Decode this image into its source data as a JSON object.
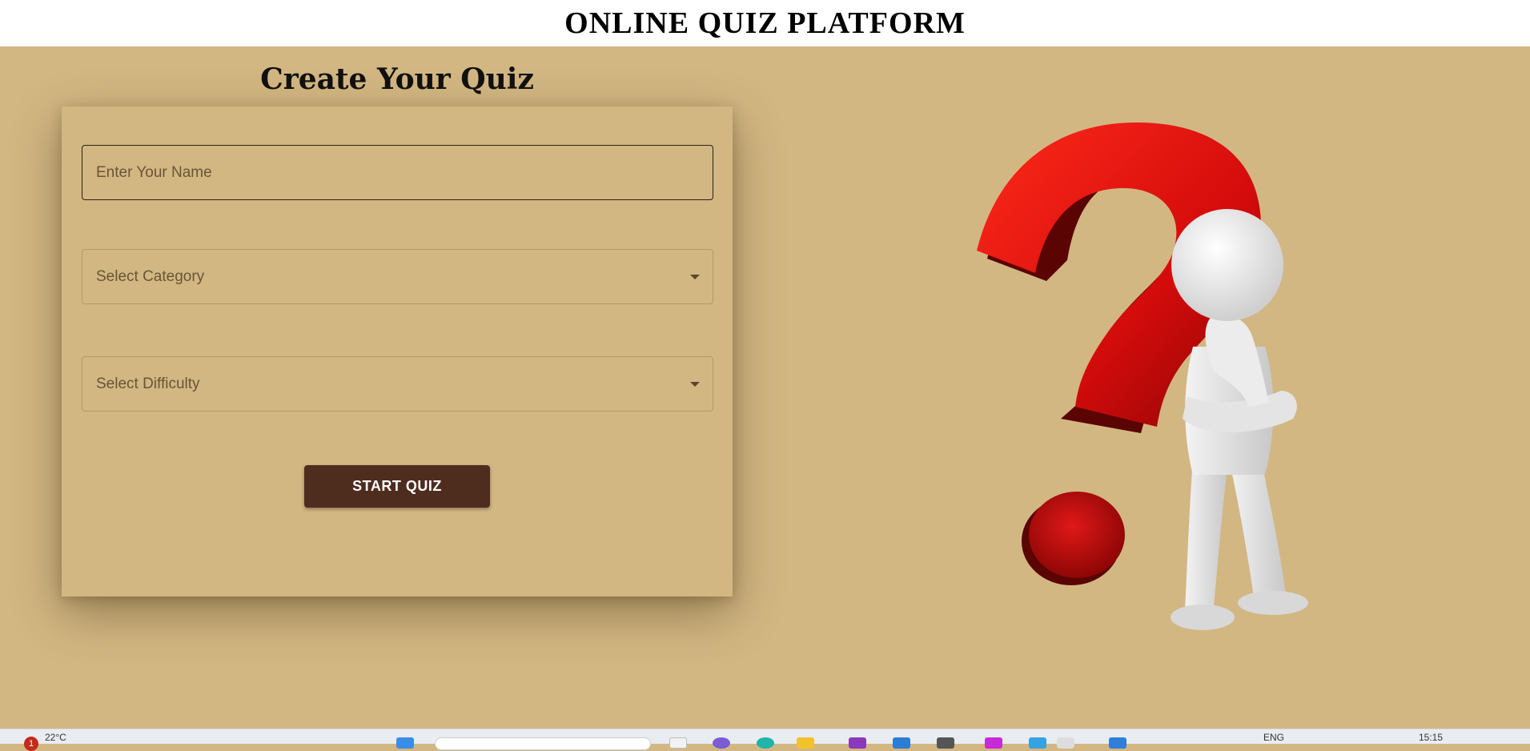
{
  "header": {
    "title": "ONLINE QUIZ PLATFORM"
  },
  "form": {
    "title": "Create Your Quiz",
    "name_placeholder": "Enter Your Name",
    "category_placeholder": "Select Category",
    "difficulty_placeholder": "Select Difficulty",
    "start_label": "START QUIZ"
  },
  "illustration": {
    "description_icon": "question-mark-thinking-figure"
  },
  "taskbar": {
    "weather": "22°C",
    "notification_count": "1",
    "language": "ENG",
    "time": "15:15"
  },
  "colors": {
    "background": "#D2B783",
    "button": "#4E2C1E",
    "question_mark": "#D30B0B"
  }
}
